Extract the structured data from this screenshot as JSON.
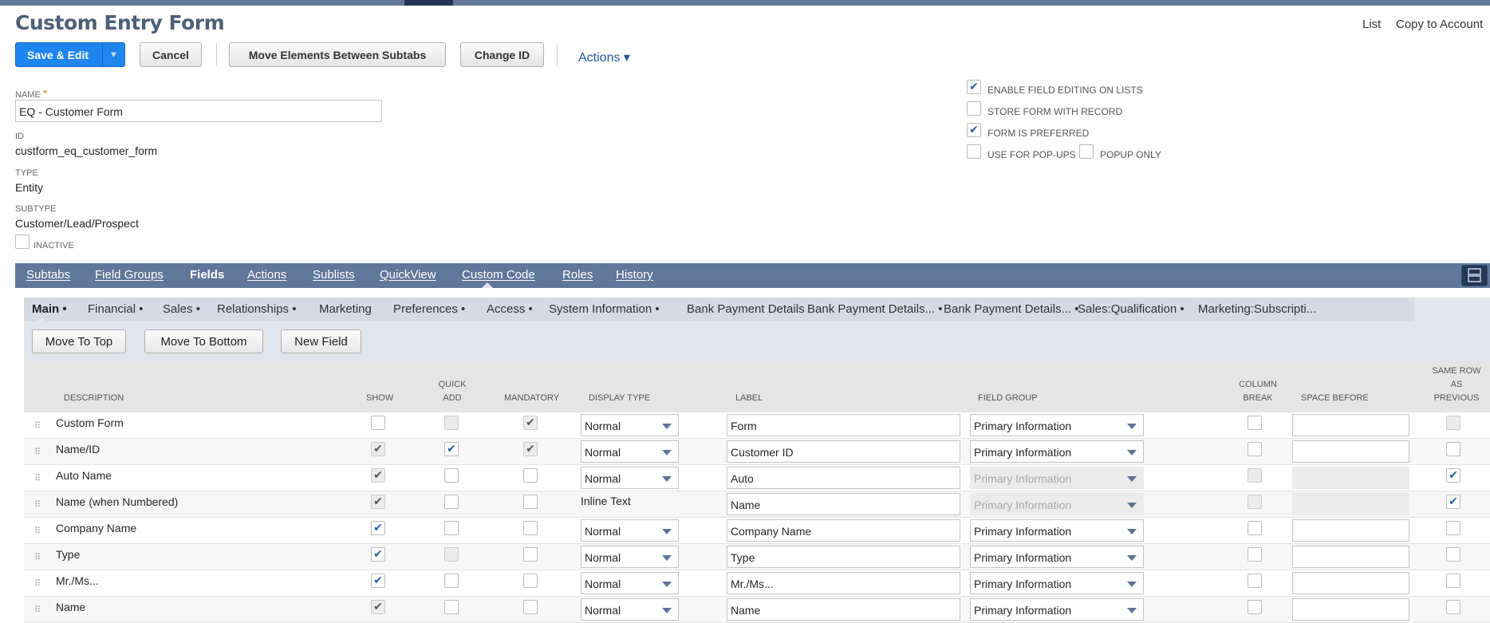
{
  "page": {
    "title": "Custom Entry Form"
  },
  "toolbar": {
    "save_label": "Save & Edit",
    "cancel_label": "Cancel",
    "move_label": "Move Elements Between Subtabs",
    "change_id_label": "Change ID",
    "actions_label": "Actions ▾"
  },
  "links": {
    "list": "List",
    "copy": "Copy to Account"
  },
  "form": {
    "name_label": "NAME",
    "name_required": "*",
    "name_value": "EQ - Customer Form",
    "id_label": "ID",
    "id_value": "custform_eq_customer_form",
    "type_label": "TYPE",
    "type_value": "Entity",
    "subtype_label": "SUBTYPE",
    "subtype_value": "Customer/Lead/Prospect",
    "inactive_label": "INACTIVE"
  },
  "options": [
    {
      "label": "ENABLE FIELD EDITING ON LISTS",
      "checked": true
    },
    {
      "label": "STORE FORM WITH RECORD",
      "checked": false
    },
    {
      "label": "FORM IS PREFERRED",
      "checked": true
    },
    {
      "label": "USE FOR POP-UPS",
      "checked": false
    },
    {
      "label": "POPUP ONLY",
      "checked": false
    }
  ],
  "tabs": [
    "Subtabs",
    "Field Groups",
    "Fields",
    "Actions",
    "Sublists",
    "QuickView",
    "Custom Code",
    "Roles",
    "History"
  ],
  "active_tab": "Fields",
  "subtabs": [
    "Main •",
    "Financial •",
    "Sales •",
    "Relationships •",
    "Marketing",
    "Preferences •",
    "Access •",
    "System Information •",
    "Bank Payment Details",
    "Bank Payment Details... •",
    "Bank Payment Details... •",
    "Sales:Qualification •",
    "Marketing:Subscripti..."
  ],
  "panel_buttons": {
    "top": "Move To Top",
    "bottom": "Move To Bottom",
    "new": "New Field"
  },
  "columns": {
    "description": "DESCRIPTION",
    "show": "SHOW",
    "quick_add": "QUICK ADD",
    "mandatory": "MANDATORY",
    "display_type": "DISPLAY TYPE",
    "label": "LABEL",
    "field_group": "FIELD GROUP",
    "column_break": "COLUMN BREAK",
    "space_before": "SPACE BEFORE",
    "same_row": "SAME ROW AS PREVIOUS"
  },
  "rows": [
    {
      "description": "Custom Form",
      "show": "off",
      "quick_add": "disabled",
      "mandatory": "gray",
      "display_type": "Normal",
      "display_select": true,
      "label": "Form",
      "field_group": "Primary Information",
      "group_disabled": false,
      "column_break": "off",
      "space_before": "",
      "space_disabled": false,
      "same_row": "disabled"
    },
    {
      "description": "Name/ID",
      "show": "gray",
      "quick_add": "blue",
      "mandatory": "gray",
      "display_type": "Normal",
      "display_select": true,
      "label": "Customer ID",
      "field_group": "Primary Information",
      "group_disabled": false,
      "column_break": "off",
      "space_before": "",
      "space_disabled": false,
      "same_row": "off"
    },
    {
      "description": "Auto Name",
      "show": "gray",
      "quick_add": "off",
      "mandatory": "off",
      "display_type": "Normal",
      "display_select": true,
      "label": "Auto",
      "field_group": "Primary Information",
      "group_disabled": true,
      "column_break": "disabled",
      "space_before": "",
      "space_disabled": true,
      "same_row": "blue"
    },
    {
      "description": "Name (when Numbered)",
      "show": "gray",
      "quick_add": "off",
      "mandatory": "off",
      "display_type": "Inline Text",
      "display_select": false,
      "label": "Name",
      "field_group": "Primary Information",
      "group_disabled": true,
      "column_break": "disabled",
      "space_before": "",
      "space_disabled": true,
      "same_row": "blue"
    },
    {
      "description": "Company Name",
      "show": "blue",
      "quick_add": "off",
      "mandatory": "off",
      "display_type": "Normal",
      "display_select": true,
      "label": "Company Name",
      "field_group": "Primary Information",
      "group_disabled": false,
      "column_break": "off",
      "space_before": "",
      "space_disabled": false,
      "same_row": "off"
    },
    {
      "description": "Type",
      "show": "blue",
      "quick_add": "disabled",
      "mandatory": "off",
      "display_type": "Normal",
      "display_select": true,
      "label": "Type",
      "field_group": "Primary Information",
      "group_disabled": false,
      "column_break": "off",
      "space_before": "",
      "space_disabled": false,
      "same_row": "off"
    },
    {
      "description": "Mr./Ms...",
      "show": "blue",
      "quick_add": "off",
      "mandatory": "off",
      "display_type": "Normal",
      "display_select": true,
      "label": "Mr./Ms...",
      "field_group": "Primary Information",
      "group_disabled": false,
      "column_break": "off",
      "space_before": "",
      "space_disabled": false,
      "same_row": "off"
    },
    {
      "description": "Name",
      "show": "gray",
      "quick_add": "off",
      "mandatory": "off",
      "display_type": "Normal",
      "display_select": true,
      "label": "Name",
      "field_group": "Primary Information",
      "group_disabled": false,
      "column_break": "off",
      "space_before": "",
      "space_disabled": false,
      "same_row": "off"
    }
  ],
  "colors": {
    "accent": "#1f86f0",
    "tabbar": "#607799",
    "check": "#245fa8"
  }
}
